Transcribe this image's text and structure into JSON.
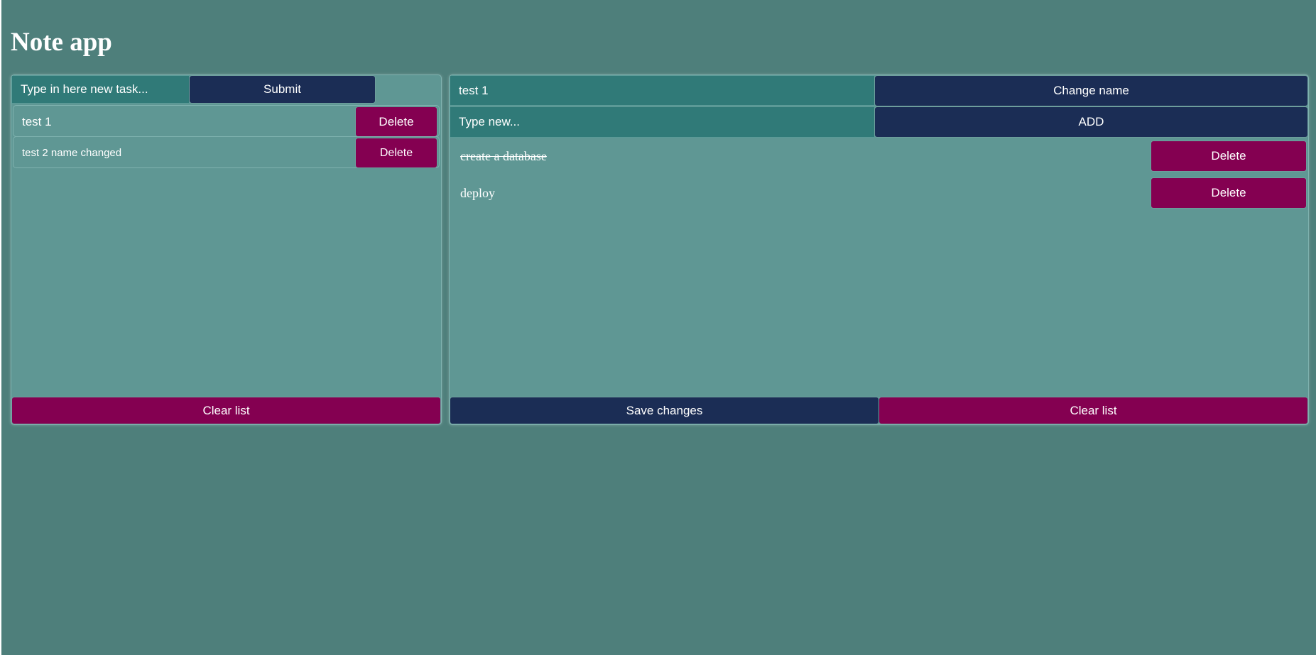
{
  "app": {
    "title": "Note app"
  },
  "colors": {
    "background": "#4e7f7b",
    "panel": "#5f9794",
    "input": "#307a78",
    "navy_button": "#1b2d55",
    "magenta_button": "#840051",
    "text": "#ffffff"
  },
  "notes_panel": {
    "new_note_placeholder": "Type in here new task...",
    "submit_label": "Submit",
    "notes": [
      {
        "name": "test 1",
        "delete_label": "Delete"
      },
      {
        "name": "test 2 name changed",
        "delete_label": "Delete"
      }
    ],
    "clear_label": "Clear list"
  },
  "detail_panel": {
    "note_name_value": "test 1",
    "change_name_label": "Change name",
    "new_task_placeholder": "Type new...",
    "add_label": "ADD",
    "tasks": [
      {
        "text": "create a database",
        "done": true,
        "delete_label": "Delete"
      },
      {
        "text": "deploy",
        "done": false,
        "delete_label": "Delete"
      }
    ],
    "save_label": "Save changes",
    "clear_label": "Clear list"
  }
}
